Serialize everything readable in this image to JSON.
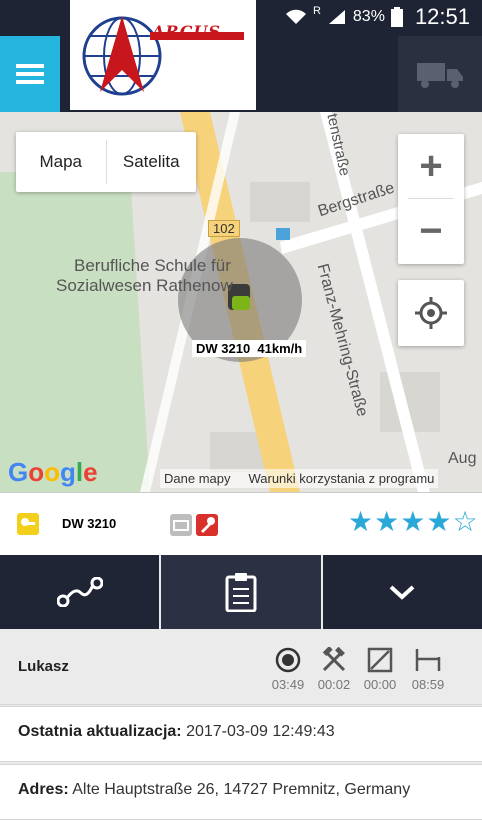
{
  "status": {
    "r_label": "R",
    "battery": "83%",
    "time": "12:51"
  },
  "header": {
    "logo_text": "ARCUS",
    "menu_icon": "hamburger-icon",
    "truck_icon": "truck-icon"
  },
  "map": {
    "type_map": "Mapa",
    "type_satellite": "Satelita",
    "zoom_in": "+",
    "zoom_out": "−",
    "road_number": "102",
    "place_line1": "Berufliche Schule für",
    "place_line2": "Sozialwesen Rathenow",
    "street_berg": "Bergstraße",
    "street_franz": "Franz-Mehring-Straße",
    "street_ten": "tenstraße",
    "street_aug": "Aug",
    "vehicle_label": "DW 3210  41km/h",
    "google": "Google",
    "map_data": "Dane mapy",
    "terms": "Warunki korzystania z programu"
  },
  "vehicle": {
    "name": "DW 3210",
    "rating": 4,
    "rating_max": 5,
    "accent": "#2aa9d9"
  },
  "tabs": [
    {
      "icon": "route-icon"
    },
    {
      "icon": "clipboard-icon"
    },
    {
      "icon": "chevron-down-icon"
    }
  ],
  "driver": {
    "name": "Lukasz",
    "activities": [
      {
        "icon": "driving-icon",
        "time": "03:49"
      },
      {
        "icon": "work-icon",
        "time": "00:02"
      },
      {
        "icon": "availability-icon",
        "time": "00:00"
      },
      {
        "icon": "rest-icon",
        "time": "08:59"
      }
    ]
  },
  "last_update": {
    "label": "Ostatnia aktualizacja:",
    "value": "2017-03-09 12:49:43"
  },
  "address": {
    "label": "Adres:",
    "value": "Alte Hauptstraße 26, 14727 Premnitz, Germany"
  }
}
